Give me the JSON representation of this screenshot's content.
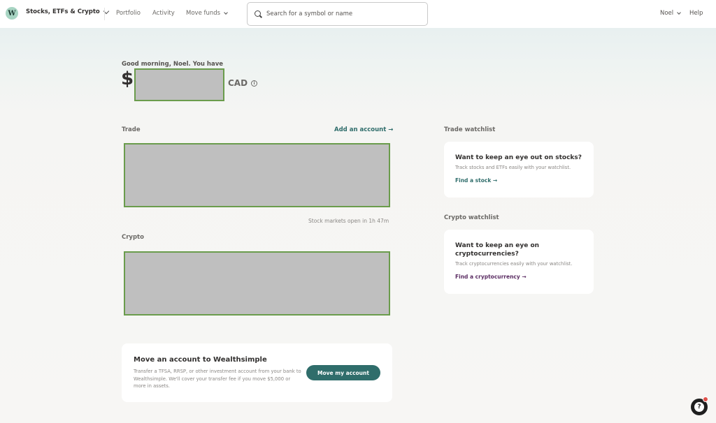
{
  "nav": {
    "logo_letter": "W",
    "product": "Stocks, ETFs & Crypto",
    "links": [
      "Portfolio",
      "Activity",
      "Move funds"
    ],
    "search_placeholder": "Search for a symbol or name",
    "user": "Noel",
    "help": "Help"
  },
  "greeting": {
    "text": "Good morning, Noel. You have",
    "currency_symbol": "$",
    "currency": "CAD",
    "info_glyph": "i"
  },
  "trade": {
    "label": "Trade",
    "add_account": "Add an account →",
    "market_status": "Stock markets open in 1h 47m"
  },
  "crypto": {
    "label": "Crypto"
  },
  "trade_watchlist": {
    "label": "Trade watchlist",
    "title": "Want to keep an eye out on stocks?",
    "subtitle": "Track stocks and ETFs easily with your watchlist.",
    "link": "Find a stock →"
  },
  "crypto_watchlist": {
    "label": "Crypto watchlist",
    "title": "Want to keep an eye on cryptocurrencies?",
    "subtitle": "Track cryptocurrencies easily with your watchlist.",
    "link": "Find a cryptocurrency →"
  },
  "move_account": {
    "title": "Move an account to Wealthsimple",
    "description": "Transfer a TFSA, RRSP, or other investment account from your bank to Wealthsimple. We'll cover your transfer fee if you move $5,000 or more in assets.",
    "button": "Move my account"
  },
  "help_widget": {
    "glyph": "?"
  },
  "colors": {
    "brand_teal": "#2f6d6b",
    "crypto_purple": "#5b2d63",
    "logo_mint": "#a8d5c3",
    "redaction_fill": "#bfbfbf",
    "redaction_border": "#6a9c4c",
    "notification_red": "#e0524b"
  }
}
